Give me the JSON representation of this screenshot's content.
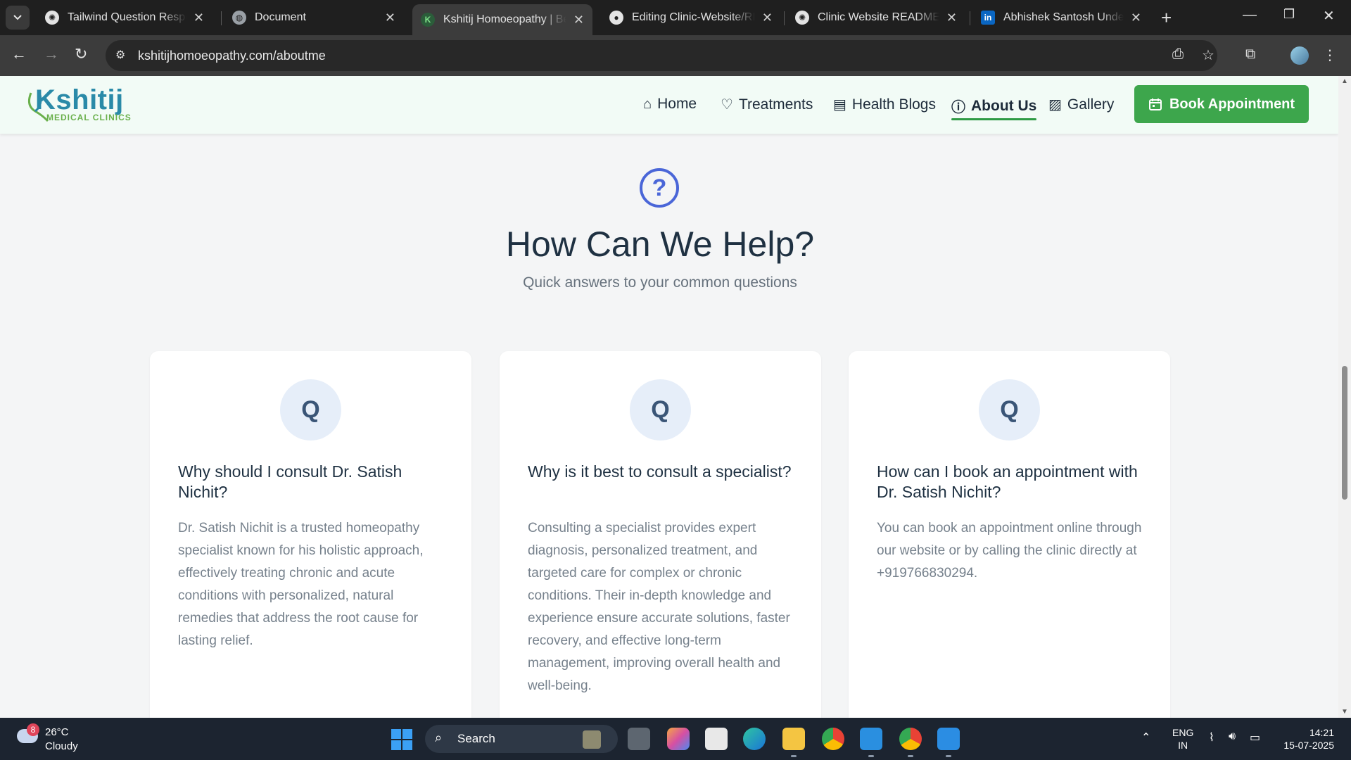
{
  "browser": {
    "tabs": [
      {
        "title": "Tailwind Question Respons",
        "favicon": "chatgpt-icon",
        "active": false
      },
      {
        "title": "Document",
        "favicon": "globe-icon",
        "active": false
      },
      {
        "title": "Kshitij Homoeopathy | Best",
        "favicon": "kshitij-favicon",
        "favicon_letter": "K",
        "active": true
      },
      {
        "title": "Editing Clinic-Website/REA",
        "favicon": "github-icon",
        "active": false
      },
      {
        "title": "Clinic Website README Gu",
        "favicon": "chatgpt-icon",
        "active": false
      },
      {
        "title": "Abhishek Santosh Unde | L",
        "favicon": "linkedin-icon",
        "favicon_letter": "in",
        "active": false
      }
    ],
    "url": "kshitijhomoeopathy.com/aboutme"
  },
  "site": {
    "logo": {
      "brand": "Kshitij",
      "tagline": "MEDICAL CLINICS"
    },
    "nav": [
      {
        "label": "Home",
        "icon": "home-icon",
        "glyph": "⌂",
        "active": false
      },
      {
        "label": "Treatments",
        "icon": "heart-pulse-icon",
        "glyph": "♡",
        "active": false
      },
      {
        "label": "Health Blogs",
        "icon": "document-icon",
        "glyph": "▤",
        "active": false
      },
      {
        "label": "About Us",
        "icon": "info-icon",
        "glyph": "ⓘ",
        "active": true
      },
      {
        "label": "Gallery",
        "icon": "gallery-icon",
        "glyph": "▨",
        "active": false
      }
    ],
    "cta": {
      "label": "Book Appointment",
      "icon": "calendar-icon"
    },
    "colors": {
      "accent_green": "#3da64c",
      "question_blue": "#4a66d8",
      "heading": "#1f3142"
    }
  },
  "faq": {
    "icon_glyph": "?",
    "title": "How Can We Help?",
    "subtitle": "Quick answers to your common questions",
    "badge": "Q",
    "items": [
      {
        "question": "Why should I consult Dr. Satish Nichit?",
        "answer": "Dr. Satish Nichit is a trusted homeopathy specialist known for his holistic approach, effectively treating chronic and acute conditions with personalized, natural remedies that address the root cause for lasting relief."
      },
      {
        "question": "Why is it best to consult a specialist?",
        "answer": "Consulting a specialist provides expert diagnosis, personalized treatment, and targeted care for complex or chronic conditions. Their in-depth knowledge and experience ensure accurate solutions, faster recovery, and effective long-term management, improving overall health and well-being."
      },
      {
        "question": "How can I book an appointment with Dr. Satish Nichit?",
        "answer": "You can book an appointment online through our website or by calling the clinic directly at +919766830294."
      }
    ]
  },
  "taskbar": {
    "weather": {
      "badge": "8",
      "temp": "26°C",
      "condition": "Cloudy"
    },
    "search_label": "Search",
    "lang": {
      "line1": "ENG",
      "line2": "IN"
    },
    "time": "14:21",
    "date": "15-07-2025"
  }
}
